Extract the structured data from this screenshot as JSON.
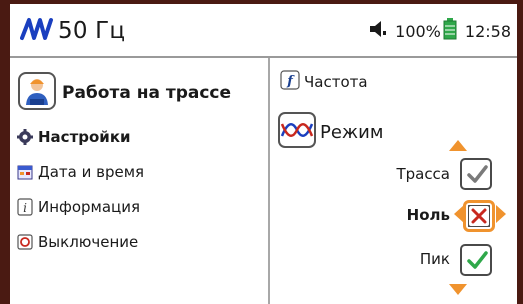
{
  "header": {
    "brand_title": "50 Гц",
    "battery_percent": "100%",
    "time": "12:58"
  },
  "left": {
    "title": "Работа на трассе",
    "menu": [
      {
        "label": "Настройки",
        "bold": true
      },
      {
        "label": "Дата и время"
      },
      {
        "label": "Информация"
      },
      {
        "label": "Выключение"
      }
    ]
  },
  "right": {
    "frequency_label": "Частота",
    "mode_label": "Режим",
    "options": [
      {
        "label": "Трасса",
        "state": "gray-check"
      },
      {
        "label": "Ноль",
        "state": "red-cross-selected"
      },
      {
        "label": "Пик",
        "state": "green-check"
      }
    ]
  },
  "colors": {
    "accent": "#f0932e",
    "frame": "#4a1a12",
    "green": "#2fa84a",
    "red": "#c8281e",
    "blue_wave": "#1a3fbf"
  }
}
